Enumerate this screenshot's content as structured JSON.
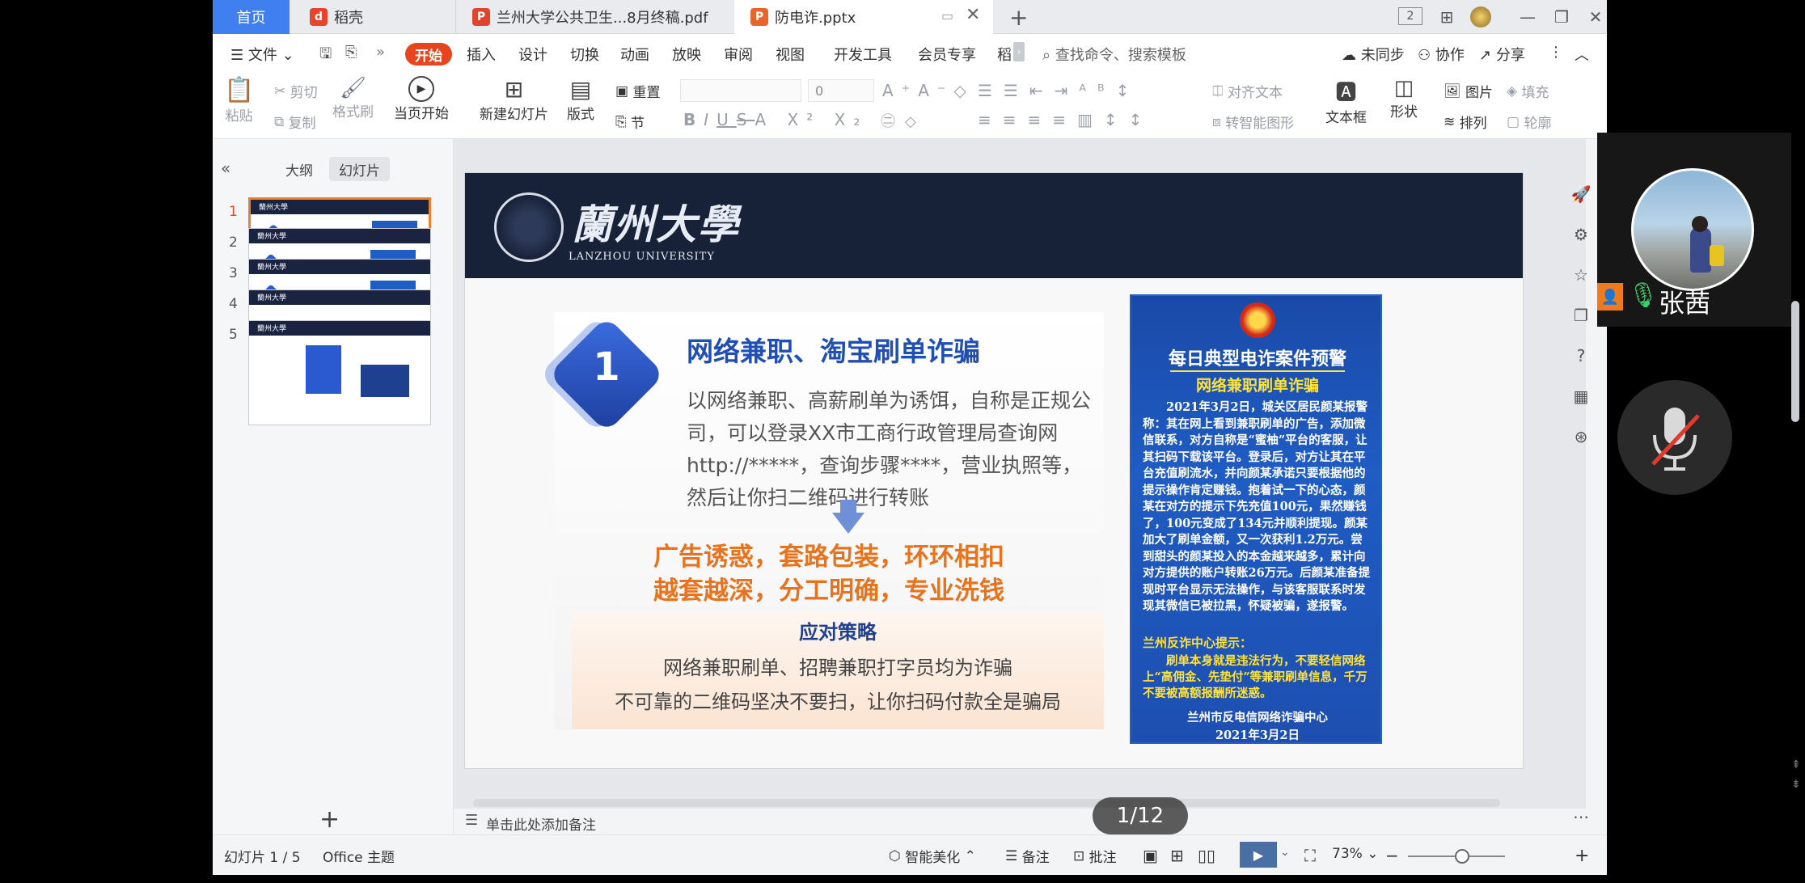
{
  "titlebar": {
    "home_tab": "首页",
    "tabs": [
      {
        "label": "稻壳"
      },
      {
        "label": "兰州大学公共卫生...8月终稿.pdf"
      },
      {
        "label": "防电诈.pptx"
      }
    ],
    "add_tab": "+",
    "badge_2": "2"
  },
  "menubar": {
    "file": "文件",
    "items": [
      "开始",
      "插入",
      "设计",
      "切换",
      "动画",
      "放映",
      "审阅",
      "视图",
      "开发工具",
      "会员专享",
      "稻"
    ],
    "search_placeholder": "查找命令、搜索模板",
    "unsynced": "未同步",
    "collab": "协作",
    "share": "分享"
  },
  "ribbon": {
    "paste": "粘贴",
    "cut": "剪切",
    "copy": "复制",
    "format_painter": "格式刷",
    "from_start": "当页开始",
    "new_slide": "新建幻灯片",
    "layout": "版式",
    "reset": "重置",
    "section": "节",
    "font_size": "0",
    "align_text": "对齐文本",
    "smart_shape": "转智能图形",
    "textbox": "文本框",
    "shape": "形状",
    "picture": "图片",
    "fill": "填充",
    "arrange": "排列",
    "outline": "轮廓"
  },
  "leftpanel": {
    "outline_tab": "大纲",
    "slides_tab": "幻灯片",
    "thumbs": [
      "1",
      "2",
      "3",
      "4",
      "5"
    ],
    "add": "+"
  },
  "slide": {
    "university_cn": "蘭州大學",
    "university_en": "LANZHOU UNIVERSITY",
    "number": "1",
    "title": "网络兼职、淘宝刷单诈骗",
    "body": "以网络兼职、高薪刷单为诱饵，自称是正规公司，可以登录XX市工商行政管理局查询网http://*****，查询步骤****，营业执照等，然后让你扫二维码进行转账",
    "warn_1": "广告诱惑，套路包装，环环相扣",
    "warn_2": "越套越深，分工明确，专业洗钱",
    "strategy_title": "应对策略",
    "strategy_1": "网络兼职刷单、招聘兼职打字员均为诈骗",
    "strategy_2": "不可靠的二维码坚决不要扫，让你扫码付款全是骗局",
    "poster": {
      "title": "每日典型电诈案件预警",
      "subtitle": "网络兼职刷单诈骗",
      "body": "2021年3月2日，城关区居民颜某报警称：其在网上看到兼职刷单的广告，添加微信联系，对方自称是“蜜柚”平台的客服，让其扫码下载该平台。登录后，对方让其在平台充值刷流水，并向颜某承诺只要根据他的提示操作肯定赚钱。抱着试一下的心态，颜某在对方的提示下先充值100元，果然赚钱了，100元变成了134元并顺利提现。颜某加大了刷单金额，又一次获利1.2万元。尝到甜头的颜某投入的本金越来越多，累计向对方提供的账户转账26万元。后颜某准备提现时平台显示无法操作，与该客服联系时发现其微信已被拉黑，怀疑被骗，遂报警。",
      "tip_header": "兰州反诈中心提示：",
      "tip": "刷单本身就是违法行为，不要轻信网络上“高佣金、先垫付”等兼职刷单信息，千万不要被高额报酬所迷惑。",
      "org": "兰州市反电信网络诈骗中心",
      "date": "2021年3月2日"
    }
  },
  "notes_placeholder": "单击此处添加备注",
  "page_indicator": "1/12",
  "statusbar": {
    "slide_count": "幻灯片 1 / 5",
    "theme": "Office 主题",
    "beautify": "智能美化",
    "notes": "备注",
    "comments": "批注",
    "zoom": "73%"
  },
  "video": {
    "participant": "张茜"
  }
}
